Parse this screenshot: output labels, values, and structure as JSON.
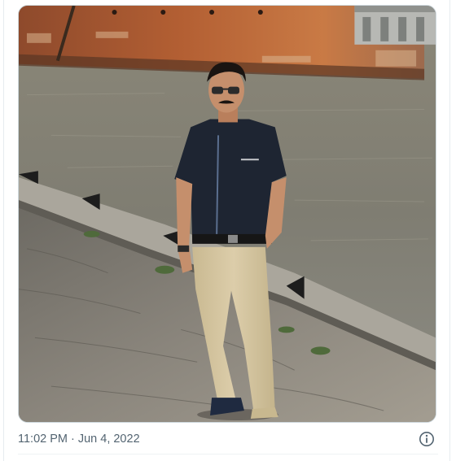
{
  "tweet": {
    "time": "11:02 PM",
    "separator": "·",
    "date": "Jun 4, 2022",
    "info_icon": "info-circle-icon"
  },
  "media": {
    "description_icon": "photo"
  },
  "colors": {
    "meta_text": "#536471",
    "border": "#cfd9de"
  }
}
